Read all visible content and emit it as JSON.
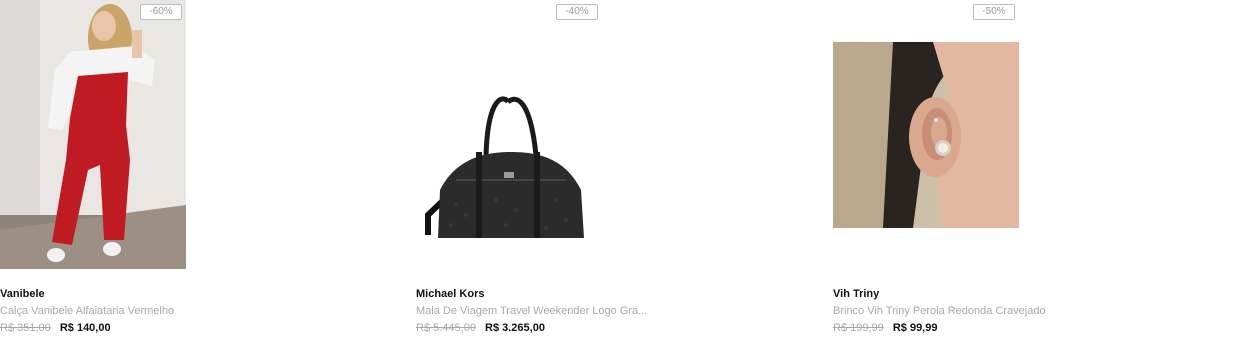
{
  "products": [
    {
      "discount": "-60%",
      "brand": "Vanibele",
      "name": "Calça Vanibele Alfaiataria Vermelho",
      "old_price": "R$ 351,00",
      "new_price": "R$ 140,00",
      "image": "woman-red-jumpsuit-photo"
    },
    {
      "discount": "-40%",
      "brand": "Michael Kors",
      "name": "Mala De Viagem Travel Weekender Logo Gra...",
      "old_price": "R$ 5.445,00",
      "new_price": "R$ 3.265,00",
      "image": "black-weekender-bag-photo"
    },
    {
      "discount": "-50%",
      "brand": "Vih Triny",
      "name": "Brinco Vih Triny Perola Redonda Cravejado",
      "old_price": "R$ 199,99",
      "new_price": "R$ 99,99",
      "image": "pearl-earring-photo"
    }
  ]
}
